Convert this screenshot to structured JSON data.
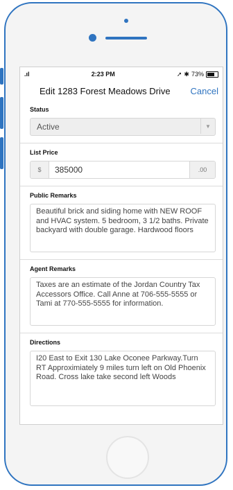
{
  "status_bar": {
    "time": "2:23 PM",
    "battery": "73%"
  },
  "nav": {
    "title": "Edit 1283 Forest Meadows Drive",
    "cancel": "Cancel"
  },
  "status": {
    "label": "Status",
    "value": "Active"
  },
  "list_price": {
    "label": "List Price",
    "prefix": "$",
    "value": "385000",
    "suffix": ".00"
  },
  "public_remarks": {
    "label": "Public Remarks",
    "value": "Beautiful brick and siding home with NEW ROOF and HVAC system. 5 bedroom, 3 1/2 baths. Private backyard with double garage. Hardwood floors"
  },
  "agent_remarks": {
    "label": "Agent Remarks",
    "value": "Taxes are an estimate of the Jordan Country Tax Accessors Office. Call Anne at 706-555-5555 or Tami at 770-555-5555 for information."
  },
  "directions": {
    "label": "Directions",
    "value": "I20 East to Exit 130 Lake Oconee Parkway.Turn RT Approximiately 9 miles turn left on Old Phoenix Road. Cross lake take second left Woods"
  },
  "colors": {
    "accent": "#2f74c0"
  }
}
